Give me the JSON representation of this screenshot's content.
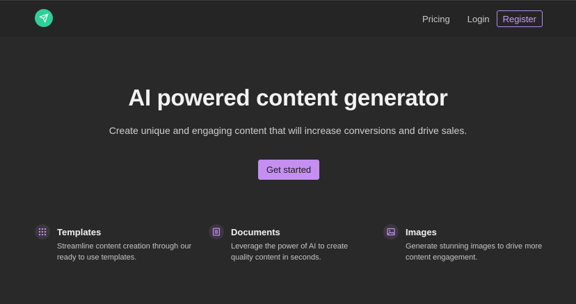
{
  "navbar": {
    "logo_icon": "paper-plane-icon",
    "links": [
      {
        "label": "Pricing"
      },
      {
        "label": "Login"
      }
    ],
    "register_label": "Register"
  },
  "hero": {
    "title": "AI powered content generator",
    "subtitle": "Create unique and engaging content that will increase conversions and drive sales.",
    "cta_label": "Get started"
  },
  "features": [
    {
      "icon": "grid-icon",
      "title": "Templates",
      "description": "Streamline content creation through our ready to use templates."
    },
    {
      "icon": "document-icon",
      "title": "Documents",
      "description": "Leverage the power of AI to create quality content in seconds."
    },
    {
      "icon": "image-icon",
      "title": "Images",
      "description": "Generate stunning images to drive more content engagement."
    }
  ],
  "colors": {
    "background": "#2a292a",
    "accent": "#c48ff1",
    "logo": "#2fcf9a"
  }
}
